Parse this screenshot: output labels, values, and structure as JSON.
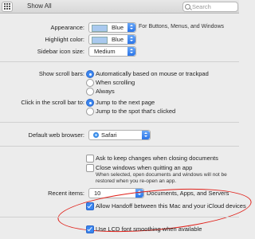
{
  "toolbar": {
    "show_all": "Show All",
    "search_placeholder": "Search"
  },
  "appearance": {
    "label": "Appearance:",
    "value": "Blue",
    "note": "For Buttons, Menus, and Windows"
  },
  "highlight": {
    "label": "Highlight color:",
    "value": "Blue"
  },
  "sidebar_icon": {
    "label": "Sidebar icon size:",
    "value": "Medium"
  },
  "scroll_bars": {
    "label": "Show scroll bars:",
    "options": [
      "Automatically based on mouse or trackpad",
      "When scrolling",
      "Always"
    ],
    "selected": 0
  },
  "click_scroll": {
    "label": "Click in the scroll bar to:",
    "options": [
      "Jump to the next page",
      "Jump to the spot that's clicked"
    ],
    "selected": 0
  },
  "browser": {
    "label": "Default web browser:",
    "value": "Safari"
  },
  "documents": {
    "ask_changes": "Ask to keep changes when closing documents",
    "close_windows": "Close windows when quitting an app",
    "close_note_1": "When selected, open documents and windows will not be",
    "close_note_2": "restored when you re-open an app."
  },
  "recent": {
    "label": "Recent items:",
    "value": "10",
    "suffix": "Documents, Apps, and Servers"
  },
  "handoff": {
    "label": "Allow Handoff between this Mac and your iCloud devices",
    "checked": true
  },
  "lcd": {
    "label": "Use LCD font smoothing when available",
    "checked": true
  }
}
